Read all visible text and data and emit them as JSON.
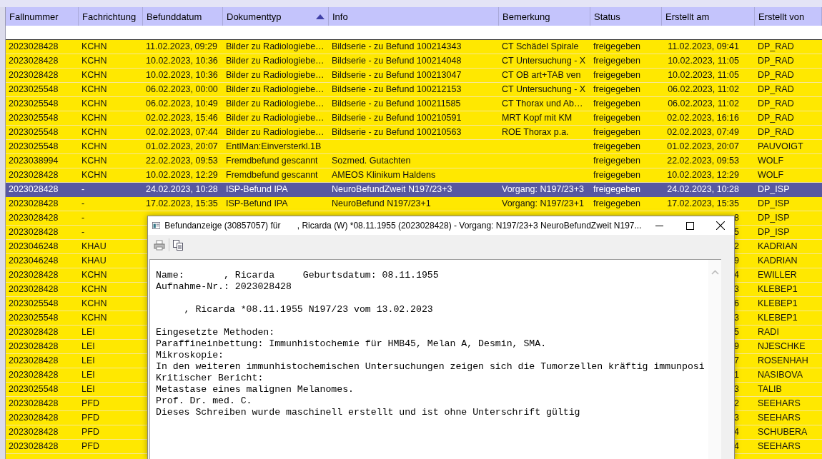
{
  "table": {
    "columns": [
      {
        "label": "Fallnummer"
      },
      {
        "label": "Fachrichtung"
      },
      {
        "label": "Befunddatum"
      },
      {
        "label": "Dokumenttyp",
        "sorted": true
      },
      {
        "label": "Info"
      },
      {
        "label": "Bemerkung"
      },
      {
        "label": "Status"
      },
      {
        "label": "Erstellt am"
      },
      {
        "label": "Erstellt von"
      }
    ],
    "rows": [
      {
        "selected": false,
        "fallnummer": "2023028428",
        "fachrichtung": "KCHN",
        "befunddatum": "11.02.2023, 09:29",
        "dokumenttyp": "Bilder zu Radiologiebe…",
        "info": "Bildserie - zu Befund 100214343",
        "bemerkung": "CT Schädel Spirale",
        "status": "freigegeben",
        "erstellt_am": "11.02.2023, 09:41",
        "erstellt_von": "DP_RAD"
      },
      {
        "selected": false,
        "fallnummer": "2023028428",
        "fachrichtung": "KCHN",
        "befunddatum": "10.02.2023, 10:36",
        "dokumenttyp": "Bilder zu Radiologiebe…",
        "info": "Bildserie - zu Befund 100214048",
        "bemerkung": "CT Untersuchung - X",
        "status": "freigegeben",
        "erstellt_am": "10.02.2023, 11:05",
        "erstellt_von": "DP_RAD"
      },
      {
        "selected": false,
        "fallnummer": "2023028428",
        "fachrichtung": "KCHN",
        "befunddatum": "10.02.2023, 10:36",
        "dokumenttyp": "Bilder zu Radiologiebe…",
        "info": "Bildserie - zu Befund 100213047",
        "bemerkung": "CT OB art+TAB ven",
        "status": "freigegeben",
        "erstellt_am": "10.02.2023, 11:05",
        "erstellt_von": "DP_RAD"
      },
      {
        "selected": false,
        "fallnummer": "2023025548",
        "fachrichtung": "KCHN",
        "befunddatum": "06.02.2023, 00:00",
        "dokumenttyp": "Bilder zu Radiologiebe…",
        "info": "Bildserie - zu Befund 100212153",
        "bemerkung": "CT Untersuchung - X",
        "status": "freigegeben",
        "erstellt_am": "06.02.2023, 11:02",
        "erstellt_von": "DP_RAD"
      },
      {
        "selected": false,
        "fallnummer": "2023025548",
        "fachrichtung": "KCHN",
        "befunddatum": "06.02.2023, 10:49",
        "dokumenttyp": "Bilder zu Radiologiebe…",
        "info": "Bildserie - zu Befund 100211585",
        "bemerkung": "CT Thorax und Ab…",
        "status": "freigegeben",
        "erstellt_am": "06.02.2023, 11:02",
        "erstellt_von": "DP_RAD"
      },
      {
        "selected": false,
        "fallnummer": "2023025548",
        "fachrichtung": "KCHN",
        "befunddatum": "02.02.2023, 15:46",
        "dokumenttyp": "Bilder zu Radiologiebe…",
        "info": "Bildserie - zu Befund 100210591",
        "bemerkung": "MRT Kopf mit KM",
        "status": "freigegeben",
        "erstellt_am": "02.02.2023, 16:16",
        "erstellt_von": "DP_RAD"
      },
      {
        "selected": false,
        "fallnummer": "2023025548",
        "fachrichtung": "KCHN",
        "befunddatum": "02.02.2023, 07:44",
        "dokumenttyp": "Bilder zu Radiologiebe…",
        "info": "Bildserie - zu Befund 100210563",
        "bemerkung": "ROE Thorax p.a.",
        "status": "freigegeben",
        "erstellt_am": "02.02.2023, 07:49",
        "erstellt_von": "DP_RAD"
      },
      {
        "selected": false,
        "fallnummer": "2023025548",
        "fachrichtung": "KCHN",
        "befunddatum": "01.02.2023, 20:07",
        "dokumenttyp": "EntlMan:Einversterkl.1B",
        "status": "freigegeben",
        "erstellt_am": "01.02.2023, 20:07",
        "erstellt_von": "PAUVOIGT"
      },
      {
        "selected": false,
        "fallnummer": "2023038994",
        "fachrichtung": "KCHN",
        "befunddatum": "22.02.2023, 09:53",
        "dokumenttyp": "Fremdbefund gescannt",
        "info": "Sozmed. Gutachten",
        "status": "freigegeben",
        "erstellt_am": "22.02.2023, 09:53",
        "erstellt_von": "WOLF"
      },
      {
        "selected": false,
        "fallnummer": "2023028428",
        "fachrichtung": "KCHN",
        "befunddatum": "10.02.2023, 12:29",
        "dokumenttyp": "Fremdbefund gescannt",
        "info": "AMEOS Klinikum Haldens",
        "status": "freigegeben",
        "erstellt_am": "10.02.2023, 12:29",
        "erstellt_von": "WOLF"
      },
      {
        "selected": true,
        "fallnummer": "2023028428",
        "fachrichtung": "-",
        "befunddatum": "24.02.2023, 10:28",
        "dokumenttyp": "ISP-Befund IPA",
        "info": "NeuroBefundZweit N197/23+3",
        "bemerkung": "Vorgang: N197/23+3",
        "status": "freigegeben",
        "erstellt_am": "24.02.2023, 10:28",
        "erstellt_von": "DP_ISP"
      },
      {
        "selected": false,
        "fallnummer": "2023028428",
        "fachrichtung": "-",
        "befunddatum": "17.02.2023, 15:35",
        "dokumenttyp": "ISP-Befund IPA",
        "info": "NeuroBefund N197/23+1",
        "bemerkung": "Vorgang: N197/23+1",
        "status": "freigegeben",
        "erstellt_am": "17.02.2023, 15:35",
        "erstellt_von": "DP_ISP"
      },
      {
        "selected": false,
        "fallnummer": "2023028428",
        "fachrichtung": "-",
        "erstellt_am": "8",
        "erstellt_von": "DP_ISP"
      },
      {
        "selected": false,
        "fallnummer": "2023028428",
        "fachrichtung": "-",
        "erstellt_am": "5",
        "erstellt_von": "DP_ISP"
      },
      {
        "selected": false,
        "fallnummer": "2023046248",
        "fachrichtung": "KHAU",
        "erstellt_am": "2",
        "erstellt_von": "KADRIAN"
      },
      {
        "selected": false,
        "fallnummer": "2023046248",
        "fachrichtung": "KHAU",
        "erstellt_am": "9",
        "erstellt_von": "KADRIAN"
      },
      {
        "selected": false,
        "fallnummer": "2023028428",
        "fachrichtung": "KCHN",
        "erstellt_am": "4",
        "erstellt_von": "EWILLER"
      },
      {
        "selected": false,
        "fallnummer": "2023028428",
        "fachrichtung": "KCHN",
        "erstellt_am": "3",
        "erstellt_von": "KLEBEP1"
      },
      {
        "selected": false,
        "fallnummer": "2023025548",
        "fachrichtung": "KCHN",
        "erstellt_am": "6",
        "erstellt_von": "KLEBEP1"
      },
      {
        "selected": false,
        "fallnummer": "2023025548",
        "fachrichtung": "KCHN",
        "erstellt_am": "3",
        "erstellt_von": "KLEBEP1"
      },
      {
        "selected": false,
        "fallnummer": "2023028428",
        "fachrichtung": "LEI",
        "erstellt_am": "5",
        "erstellt_von": "RADI"
      },
      {
        "selected": false,
        "fallnummer": "2023028428",
        "fachrichtung": "LEI",
        "erstellt_am": "9",
        "erstellt_von": "NJESCHKE"
      },
      {
        "selected": false,
        "fallnummer": "2023028428",
        "fachrichtung": "LEI",
        "erstellt_am": "7",
        "erstellt_von": "ROSENHAH"
      },
      {
        "selected": false,
        "fallnummer": "2023028428",
        "fachrichtung": "LEI",
        "erstellt_am": "1",
        "erstellt_von": "NASIBOVA"
      },
      {
        "selected": false,
        "fallnummer": "2023025548",
        "fachrichtung": "LEI",
        "erstellt_am": "3",
        "erstellt_von": "TALIB"
      },
      {
        "selected": false,
        "fallnummer": "2023028428",
        "fachrichtung": "PFD",
        "erstellt_am": "2",
        "erstellt_von": "SEEHARS"
      },
      {
        "selected": false,
        "fallnummer": "2023028428",
        "fachrichtung": "PFD",
        "erstellt_am": "3",
        "erstellt_von": "SEEHARS"
      },
      {
        "selected": false,
        "fallnummer": "2023028428",
        "fachrichtung": "PFD",
        "erstellt_am": "4",
        "erstellt_von": "SCHUBERA"
      },
      {
        "selected": false,
        "fallnummer": "2023028428",
        "fachrichtung": "PFD",
        "erstellt_am": "4",
        "erstellt_von": "SEEHARS"
      }
    ]
  },
  "dialog": {
    "title": "Befundanzeige (30857057) für       , Ricarda (W) *08.11.1955 (2023028428) - Vorgang: N197/23+3 NeuroBefundZweit N197...",
    "paragraphs": [
      [
        "Name:       , Ricarda     Geburtsdatum: 08.11.1955",
        "Aufnahme-Nr.: 2023028428"
      ],
      [
        "     , Ricarda *08.11.1955 N197/23 vom 13.02.2023"
      ],
      [
        "Eingesetzte Methoden:",
        "Paraffineinbettung: Immunhistochemie für HMB45, Melan A, Desmin, SMA.",
        "Mikroskopie:",
        "In den weiteren immunhistochemischen Untersuchungen zeigen sich die Tumorzellen kräftig immunposi",
        "Kritischer Bericht:",
        "Metastase eines malignen Melanomes.",
        "Prof. Dr. med. C.",
        "Dieses Schreiben wurde maschinell erstellt und ist ohne Unterschrift gültig"
      ]
    ]
  }
}
